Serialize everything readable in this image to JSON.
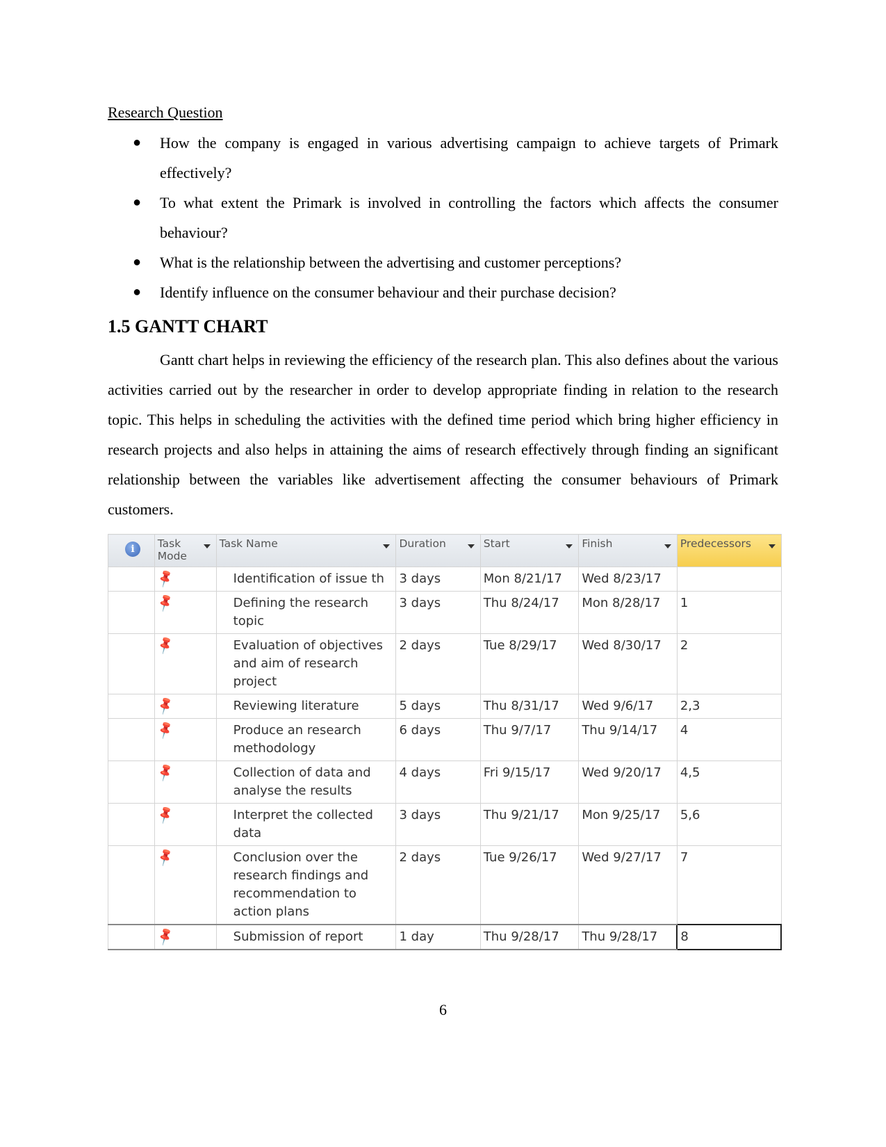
{
  "section_label": "Research Question",
  "questions": [
    "How the company is engaged in various advertising campaign to achieve targets of Primark effectively?",
    "To what extent the Primark is involved in controlling the factors which affects the consumer behaviour?",
    "What is the relationship between the advertising and customer perceptions?",
    "Identify influence on the consumer behaviour and their purchase decision?"
  ],
  "heading": "1.5 GANTT CHART",
  "paragraph": "Gantt chart helps in reviewing the efficiency of the research plan. This also defines about the various activities carried out by the researcher in order to develop appropriate finding in relation to the research topic. This helps in scheduling the activities with the defined time period which bring higher efficiency in research projects and also helps in attaining the aims of research effectively through finding an significant relationship between the variables like advertisement affecting the consumer behaviours of Primark customers.",
  "table": {
    "columns": {
      "info": "i",
      "task_mode": "Task Mode",
      "task_name": "Task Name",
      "duration": "Duration",
      "start": "Start",
      "finish": "Finish",
      "predecessors": "Predecessors"
    },
    "task_mode_icon": "pin-icon",
    "rows": [
      {
        "name": "Identification of issue th",
        "duration": "3 days",
        "start": "Mon 8/21/17",
        "finish": "Wed 8/23/17",
        "pred": ""
      },
      {
        "name": "Defining the research topic",
        "duration": "3 days",
        "start": "Thu 8/24/17",
        "finish": "Mon 8/28/17",
        "pred": "1"
      },
      {
        "name": "Evaluation of objectives and aim of research project",
        "duration": "2 days",
        "start": "Tue 8/29/17",
        "finish": "Wed 8/30/17",
        "pred": "2"
      },
      {
        "name": "Reviewing literature",
        "duration": "5 days",
        "start": "Thu 8/31/17",
        "finish": "Wed 9/6/17",
        "pred": "2,3"
      },
      {
        "name": "Produce an research methodology",
        "duration": "6 days",
        "start": "Thu 9/7/17",
        "finish": "Thu 9/14/17",
        "pred": "4"
      },
      {
        "name": "Collection of data and analyse the results",
        "duration": "4 days",
        "start": "Fri 9/15/17",
        "finish": "Wed 9/20/17",
        "pred": "4,5"
      },
      {
        "name": "Interpret the collected data",
        "duration": "3 days",
        "start": "Thu 9/21/17",
        "finish": "Mon 9/25/17",
        "pred": "5,6"
      },
      {
        "name": "Conclusion over the research findings and recommendation to action plans",
        "duration": "2 days",
        "start": "Tue 9/26/17",
        "finish": "Wed 9/27/17",
        "pred": "7"
      },
      {
        "name": "Submission of report",
        "duration": "1 day",
        "start": "Thu 9/28/17",
        "finish": "Thu 9/28/17",
        "pred": "8"
      }
    ]
  },
  "page_number": "6"
}
